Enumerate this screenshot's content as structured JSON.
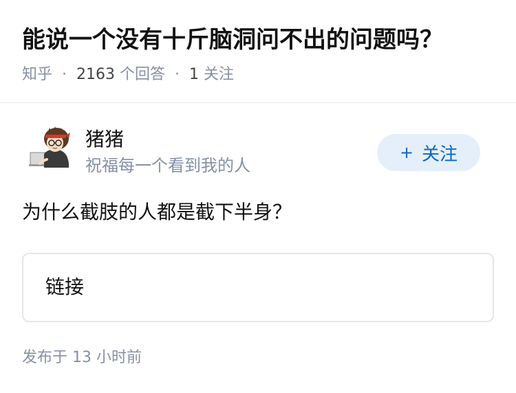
{
  "question": {
    "title": "能说一个没有十斤脑洞问不出的问题吗？",
    "source": "知乎",
    "answer_count": "2163",
    "answer_label": "个回答",
    "follower_count": "1",
    "follower_label": "关注"
  },
  "author": {
    "name": "猪猪",
    "bio": "祝福每一个看到我的人",
    "avatar_icon": "cartoon-avatar-icon",
    "follow_plus": "+",
    "follow_label": "关注"
  },
  "answer": {
    "text": "为什么截肢的人都是截下半身？",
    "link_card_label": "链接"
  },
  "publish": {
    "prefix": "发布于",
    "amount": "13",
    "unit": "小时前"
  },
  "colors": {
    "title": "#121212",
    "meta": "#8590a6",
    "follow_bg": "#e5eff9",
    "follow_text": "#0c66c4",
    "card_border": "#e6e6e6"
  }
}
